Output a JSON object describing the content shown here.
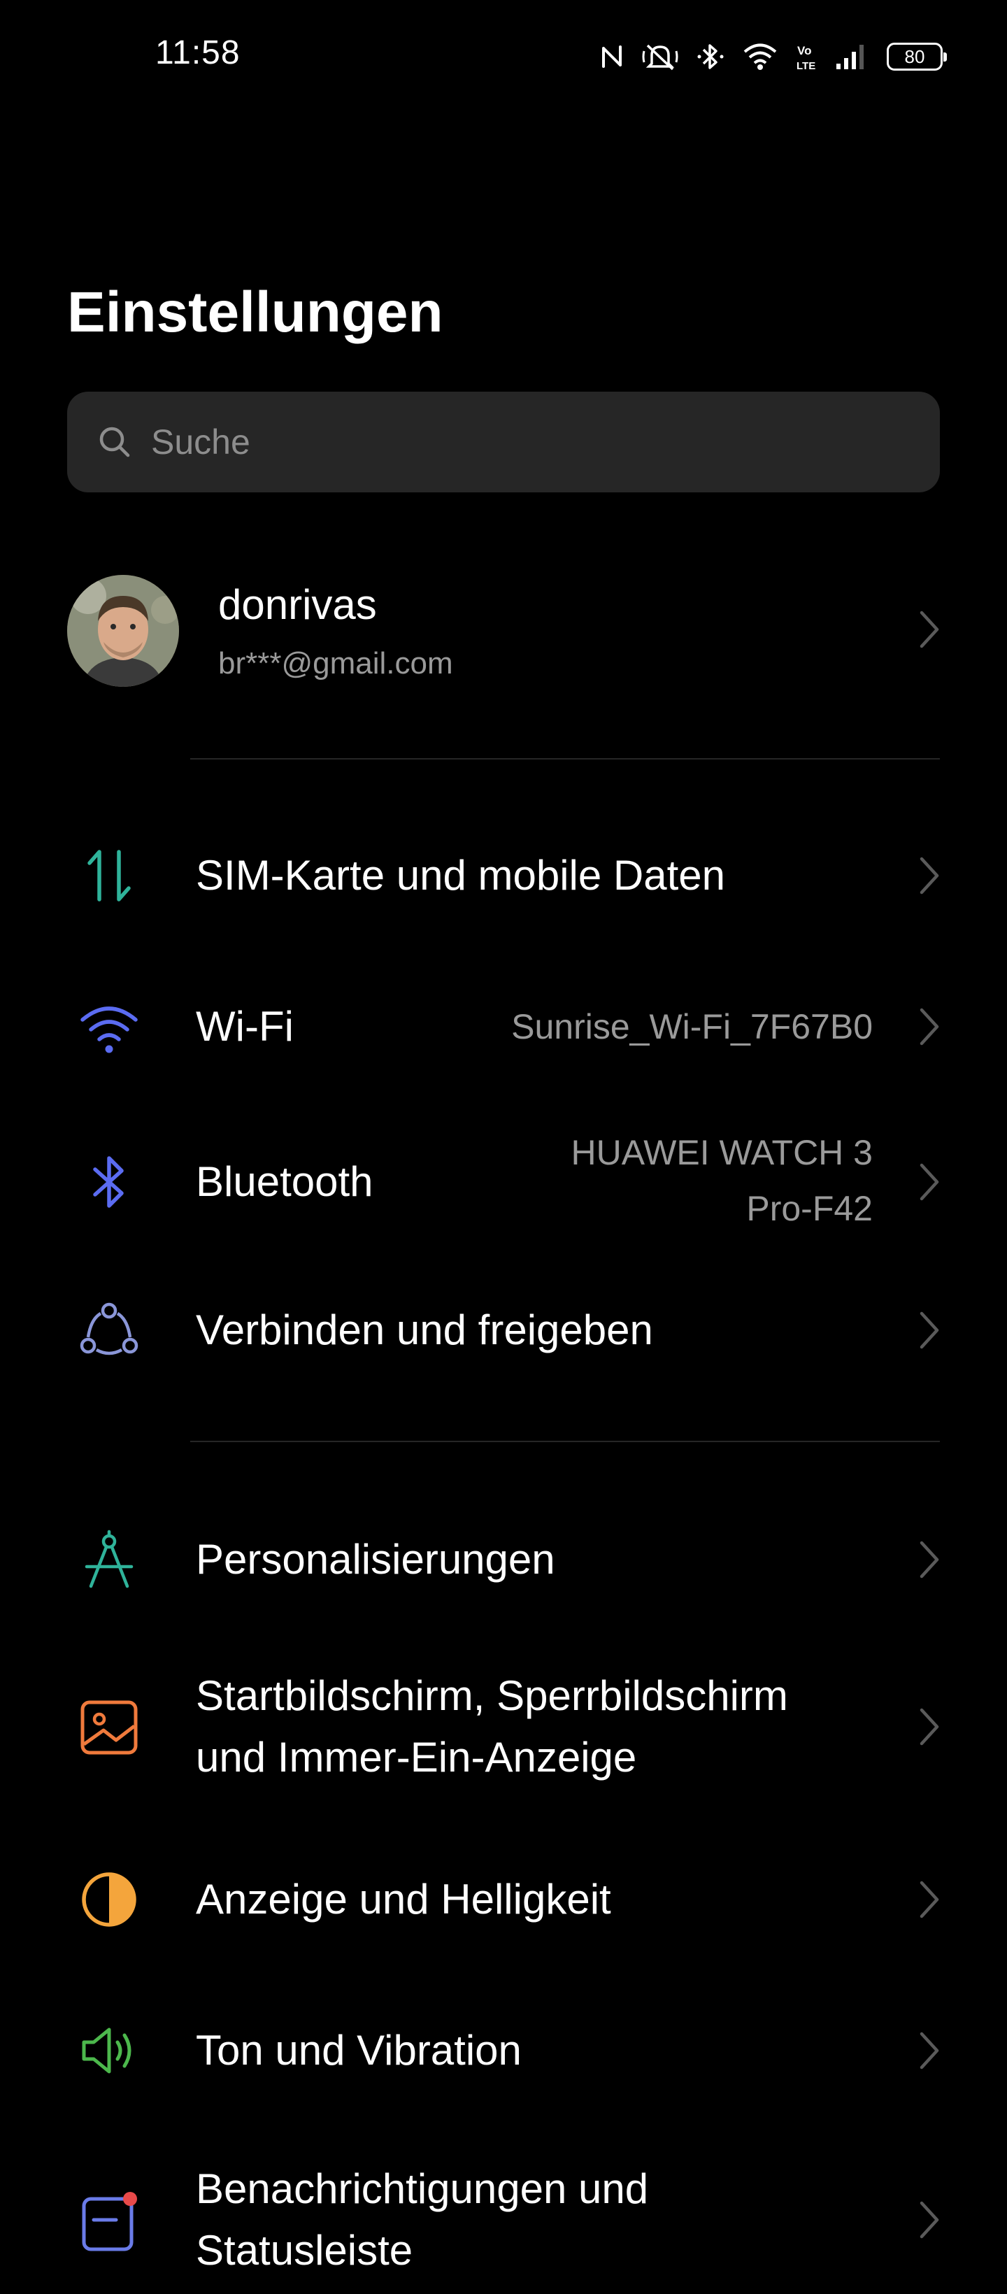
{
  "status_bar": {
    "time": "11:58",
    "battery": "80",
    "icons": [
      "nfc-icon",
      "mute-icon",
      "bluetooth-icon",
      "wifi-icon",
      "volte-icon",
      "signal-icon",
      "battery-icon"
    ]
  },
  "page": {
    "title": "Einstellungen"
  },
  "search": {
    "placeholder": "Suche"
  },
  "account": {
    "name": "donrivas",
    "email": "br***@gmail.com"
  },
  "settings": [
    {
      "label": "SIM-Karte und mobile Daten",
      "value": "",
      "icon": "sim-data-icon",
      "color": "#2fb39a"
    },
    {
      "label": "Wi-Fi",
      "value": "Sunrise_Wi-Fi_7F67B0",
      "icon": "wifi-icon",
      "color": "#5b6cf2"
    },
    {
      "label": "Bluetooth",
      "value_line1": "HUAWEI WATCH 3",
      "value_line2": "Pro-F42",
      "icon": "bluetooth-icon",
      "color": "#5b6cf2"
    },
    {
      "label": "Verbinden und freigeben",
      "value": "",
      "icon": "connect-share-icon",
      "color": "#8a96d8"
    },
    {
      "label": "Personalisierungen",
      "value": "",
      "icon": "compass-icon",
      "color": "#2fb39a"
    },
    {
      "label_line1": "Startbildschirm, Sperrbildschirm",
      "label_line2": "und Immer-Ein-Anzeige",
      "icon": "wallpaper-icon",
      "color": "#f07a3c"
    },
    {
      "label": "Anzeige und Helligkeit",
      "value": "",
      "icon": "brightness-icon",
      "color": "#f4a53c"
    },
    {
      "label": "Ton und Vibration",
      "value": "",
      "icon": "speaker-icon",
      "color": "#4cb84c"
    },
    {
      "label_line1": "Benachrichtigungen und",
      "label_line2": "Statusleiste",
      "icon": "notification-icon",
      "color": "#6a7be8"
    }
  ]
}
